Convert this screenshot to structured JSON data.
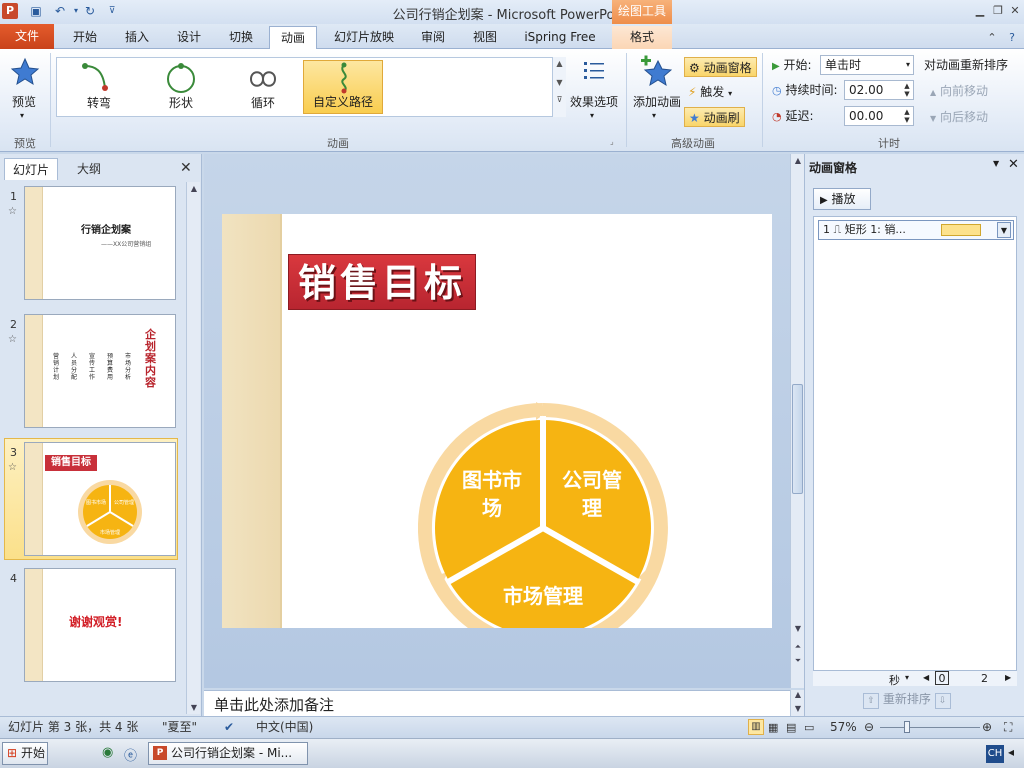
{
  "window": {
    "title": "公司行销企划案 - Microsoft PowerPoint",
    "context_tab_header": "绘图工具",
    "app_icon": "P"
  },
  "tabs": {
    "file": "文件",
    "items": [
      "开始",
      "插入",
      "设计",
      "切换",
      "动画",
      "幻灯片放映",
      "审阅",
      "视图",
      "iSpring Free"
    ],
    "active": "动画",
    "format": "格式"
  },
  "ribbon": {
    "preview": {
      "button": "预览",
      "group": "预览"
    },
    "animation_group": {
      "label": "动画",
      "gallery": [
        "转弯",
        "形状",
        "循环",
        "自定义路径"
      ],
      "selected": "自定义路径",
      "effect_options": "效果选项"
    },
    "advanced_group": {
      "label": "高级动画",
      "add_animation": "添加动画",
      "anim_pane": "动画窗格",
      "trigger": "触发",
      "anim_painter": "动画刷"
    },
    "timing_group": {
      "label": "计时",
      "start_label": "开始:",
      "start_value": "单击时",
      "duration_label": "持续时间:",
      "duration_value": "02.00",
      "delay_label": "延迟:",
      "delay_value": "00.00",
      "reorder_title": "对动画重新排序",
      "move_earlier": "向前移动",
      "move_later": "向后移动"
    }
  },
  "left_panel": {
    "tab_slides": "幻灯片",
    "tab_outline": "大纲",
    "slides": [
      {
        "num": "1",
        "title": "行销企划案",
        "subtitle": "——XX公司营销组"
      },
      {
        "num": "2",
        "title": "企划案内容",
        "columns": [
          "营销计划",
          "人员分配",
          "宣传工作",
          "预算费用",
          "市场分析"
        ]
      },
      {
        "num": "3",
        "title": "销售目标",
        "labels": [
          "图书市场",
          "公司管理",
          "市场管理"
        ]
      },
      {
        "num": "4",
        "title": "谢谢观赏!"
      }
    ],
    "selected": "3"
  },
  "slide": {
    "title": "销售目标",
    "segments": [
      {
        "label_line1": "图书市",
        "label_line2": "场"
      },
      {
        "label_line1": "公司管",
        "label_line2": "理"
      },
      {
        "label_line1": "市场管理",
        "label_line2": ""
      }
    ],
    "colors": {
      "segment_fill": "#f6b412",
      "segment_outer": "#f9d9a2",
      "title_bg": "#c8303a"
    }
  },
  "notes": {
    "placeholder": "单击此处添加备注"
  },
  "anim_pane": {
    "title": "动画窗格",
    "play": "播放",
    "item": "1 ⎍ 矩形 1: 销...",
    "timeline_unit": "秒",
    "timeline_start": "0",
    "timeline_end": "2",
    "reorder": "重新排序"
  },
  "status": {
    "slide_info": "幻灯片 第 3 张，共 4 张",
    "theme": "\"夏至\"",
    "language": "中文(中国)",
    "zoom": "57%"
  },
  "taskbar": {
    "start": "开始",
    "task": "公司行销企划案 - Mi...",
    "ime": "CH"
  }
}
